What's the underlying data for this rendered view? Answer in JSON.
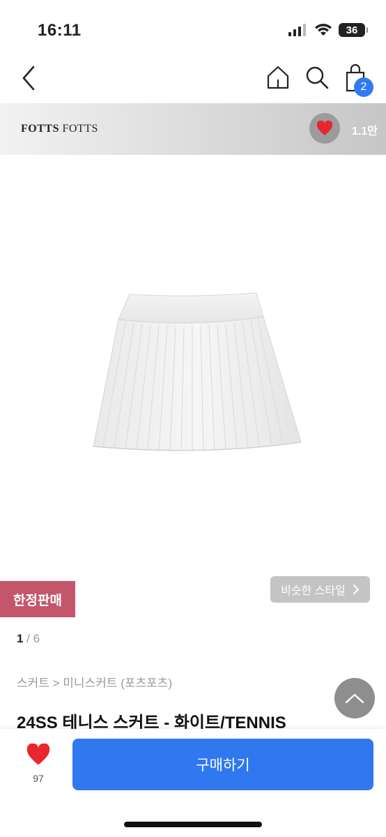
{
  "status_bar": {
    "time": "16:11",
    "battery": "36"
  },
  "header": {
    "cart_count": "2"
  },
  "brand": {
    "name_bold": "FOTTS",
    "name_regular": "FOTTS",
    "favorite_count": "1.1만"
  },
  "product": {
    "limited_badge": "한정판매",
    "similar_style_label": "비슷한 스타일",
    "image_index": "1",
    "image_total": "6",
    "breadcrumb": "스커트 > 미니스커트 (포츠포츠)",
    "title": "24SS 테니스 스커트 - 화이트/TENNIS"
  },
  "bottom_bar": {
    "like_count": "97",
    "buy_label": "구매하기"
  },
  "colors": {
    "accent": "#2f78f0",
    "limited": "#c4566b",
    "heart": "#e8262e"
  }
}
